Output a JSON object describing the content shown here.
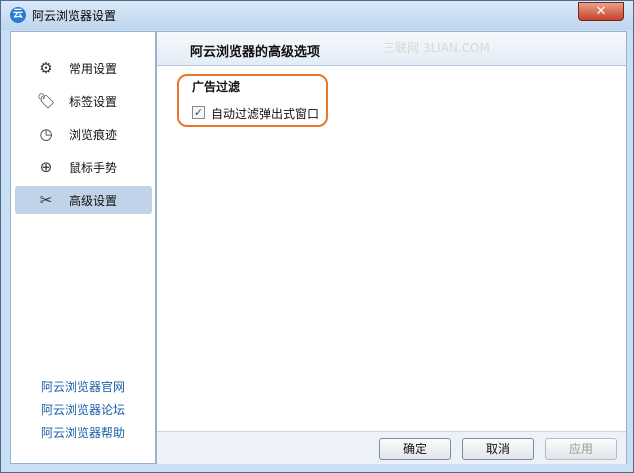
{
  "window": {
    "title": "阿云浏览器设置",
    "app_icon_glyph": "云",
    "close_glyph": "✕"
  },
  "sidebar": {
    "items": [
      {
        "label": "常用设置",
        "icon": "gear-icon",
        "glyph": "⚙",
        "active": false
      },
      {
        "label": "标签设置",
        "icon": "tag-icon",
        "glyph": "🏷",
        "active": false
      },
      {
        "label": "浏览痕迹",
        "icon": "clock-icon",
        "glyph": "◷",
        "active": false
      },
      {
        "label": "鼠标手势",
        "icon": "mouse-icon",
        "glyph": "⊕",
        "active": false
      },
      {
        "label": "高级设置",
        "icon": "tools-icon",
        "glyph": "✂",
        "active": true
      }
    ],
    "links": [
      "阿云浏览器官网",
      "阿云浏览器论坛",
      "阿云浏览器帮助"
    ]
  },
  "main": {
    "title": "阿云浏览器的高级选项",
    "watermark": "三联网 3LIAN.COM",
    "section_title": "广告过滤",
    "checkbox": {
      "label": "自动过滤弹出式窗口",
      "checked": true,
      "mark": "✓"
    }
  },
  "footer": {
    "ok": "确定",
    "cancel": "取消",
    "apply": "应用"
  },
  "colors": {
    "highlight": "#e8762d",
    "link": "#1a5ea8",
    "active_item": "#c0d3e8"
  }
}
